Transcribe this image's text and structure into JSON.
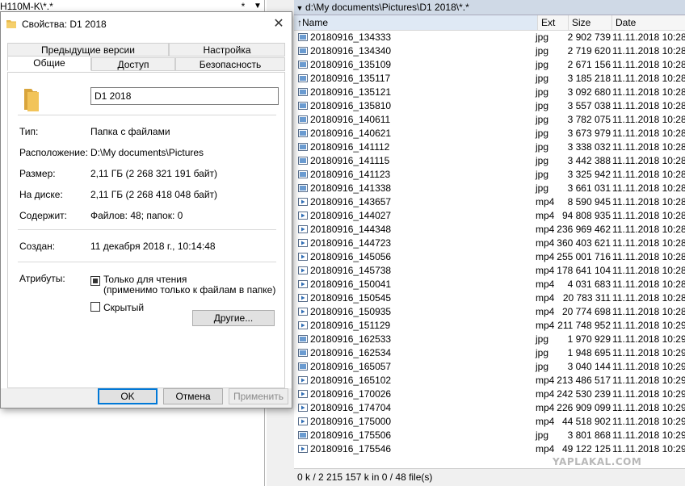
{
  "left_panel": {
    "path": "H110M-K\\*.*",
    "star": "*",
    "arrow": "▼"
  },
  "right_panel": {
    "path": "d:\\My documents\\Pictures\\D1 2018\\*.*",
    "path_arrow": "▼",
    "columns": {
      "name": "Name",
      "ext": "Ext",
      "size": "Size",
      "date": "Date",
      "sort_indicator": "↑"
    },
    "files": [
      {
        "name": "20180916_134333",
        "ext": "jpg",
        "size": "2 902 739",
        "date": "11.11.2018 10:28"
      },
      {
        "name": "20180916_134340",
        "ext": "jpg",
        "size": "2 719 620",
        "date": "11.11.2018 10:28"
      },
      {
        "name": "20180916_135109",
        "ext": "jpg",
        "size": "2 671 156",
        "date": "11.11.2018 10:28"
      },
      {
        "name": "20180916_135117",
        "ext": "jpg",
        "size": "3 185 218",
        "date": "11.11.2018 10:28"
      },
      {
        "name": "20180916_135121",
        "ext": "jpg",
        "size": "3 092 680",
        "date": "11.11.2018 10:28"
      },
      {
        "name": "20180916_135810",
        "ext": "jpg",
        "size": "3 557 038",
        "date": "11.11.2018 10:28"
      },
      {
        "name": "20180916_140611",
        "ext": "jpg",
        "size": "3 782 075",
        "date": "11.11.2018 10:28"
      },
      {
        "name": "20180916_140621",
        "ext": "jpg",
        "size": "3 673 979",
        "date": "11.11.2018 10:28"
      },
      {
        "name": "20180916_141112",
        "ext": "jpg",
        "size": "3 338 032",
        "date": "11.11.2018 10:28"
      },
      {
        "name": "20180916_141115",
        "ext": "jpg",
        "size": "3 442 388",
        "date": "11.11.2018 10:28"
      },
      {
        "name": "20180916_141123",
        "ext": "jpg",
        "size": "3 325 942",
        "date": "11.11.2018 10:28"
      },
      {
        "name": "20180916_141338",
        "ext": "jpg",
        "size": "3 661 031",
        "date": "11.11.2018 10:28"
      },
      {
        "name": "20180916_143657",
        "ext": "mp4",
        "size": "8 590 945",
        "date": "11.11.2018 10:28"
      },
      {
        "name": "20180916_144027",
        "ext": "mp4",
        "size": "94 808 935",
        "date": "11.11.2018 10:28"
      },
      {
        "name": "20180916_144348",
        "ext": "mp4",
        "size": "236 969 462",
        "date": "11.11.2018 10:28"
      },
      {
        "name": "20180916_144723",
        "ext": "mp4",
        "size": "360 403 621",
        "date": "11.11.2018 10:28"
      },
      {
        "name": "20180916_145056",
        "ext": "mp4",
        "size": "255 001 716",
        "date": "11.11.2018 10:28"
      },
      {
        "name": "20180916_145738",
        "ext": "mp4",
        "size": "178 641 104",
        "date": "11.11.2018 10:28"
      },
      {
        "name": "20180916_150041",
        "ext": "mp4",
        "size": "4 031 683",
        "date": "11.11.2018 10:28"
      },
      {
        "name": "20180916_150545",
        "ext": "mp4",
        "size": "20 783 311",
        "date": "11.11.2018 10:28"
      },
      {
        "name": "20180916_150935",
        "ext": "mp4",
        "size": "20 774 698",
        "date": "11.11.2018 10:28"
      },
      {
        "name": "20180916_151129",
        "ext": "mp4",
        "size": "211 748 952",
        "date": "11.11.2018 10:29"
      },
      {
        "name": "20180916_162533",
        "ext": "jpg",
        "size": "1 970 929",
        "date": "11.11.2018 10:29"
      },
      {
        "name": "20180916_162534",
        "ext": "jpg",
        "size": "1 948 695",
        "date": "11.11.2018 10:29"
      },
      {
        "name": "20180916_165057",
        "ext": "jpg",
        "size": "3 040 144",
        "date": "11.11.2018 10:29"
      },
      {
        "name": "20180916_165102",
        "ext": "mp4",
        "size": "213 486 517",
        "date": "11.11.2018 10:29"
      },
      {
        "name": "20180916_170026",
        "ext": "mp4",
        "size": "242 530 239",
        "date": "11.11.2018 10:29"
      },
      {
        "name": "20180916_174704",
        "ext": "mp4",
        "size": "226 909 099",
        "date": "11.11.2018 10:29"
      },
      {
        "name": "20180916_175000",
        "ext": "mp4",
        "size": "44 518 902",
        "date": "11.11.2018 10:29"
      },
      {
        "name": "20180916_175506",
        "ext": "jpg",
        "size": "3 801 868",
        "date": "11.11.2018 10:29"
      },
      {
        "name": "20180916_175546",
        "ext": "mp4",
        "size": "49 122 125",
        "date": "11.11.2018 10:29"
      }
    ],
    "status": "0 k / 2 215 157 k in 0 / 48 file(s)",
    "watermark": "YAPLAKAL.COM"
  },
  "dialog": {
    "title": "Свойства: D1 2018",
    "close": "✕",
    "tabs_row1": [
      "Предыдущие версии",
      "Настройка"
    ],
    "tabs_row2": [
      "Общие",
      "Доступ",
      "Безопасность"
    ],
    "folder_name": "D1 2018",
    "props": [
      {
        "label": "Тип:",
        "value": "Папка с файлами"
      },
      {
        "label": "Расположение:",
        "value": "D:\\My documents\\Pictures"
      },
      {
        "label": "Размер:",
        "value": "2,11 ГБ (2 268 321 191 байт)"
      },
      {
        "label": "На диске:",
        "value": "2,11 ГБ (2 268 418 048 байт)"
      },
      {
        "label": "Содержит:",
        "value": "Файлов: 48; папок: 0"
      }
    ],
    "created_label": "Создан:",
    "created_value": "11 декабря 2018 г., 10:14:48",
    "attributes_label": "Атрибуты:",
    "readonly_label": "Только для чтения",
    "readonly_note": "(применимо только к файлам в папке)",
    "hidden_label": "Скрытый",
    "other_button": "Другие...",
    "ok_button": "OK",
    "cancel_button": "Отмена",
    "apply_button": "Применить"
  },
  "colors": {
    "accent": "#0078d7",
    "folder": "#e8b84a",
    "path_bg": "#cfd9e6"
  }
}
